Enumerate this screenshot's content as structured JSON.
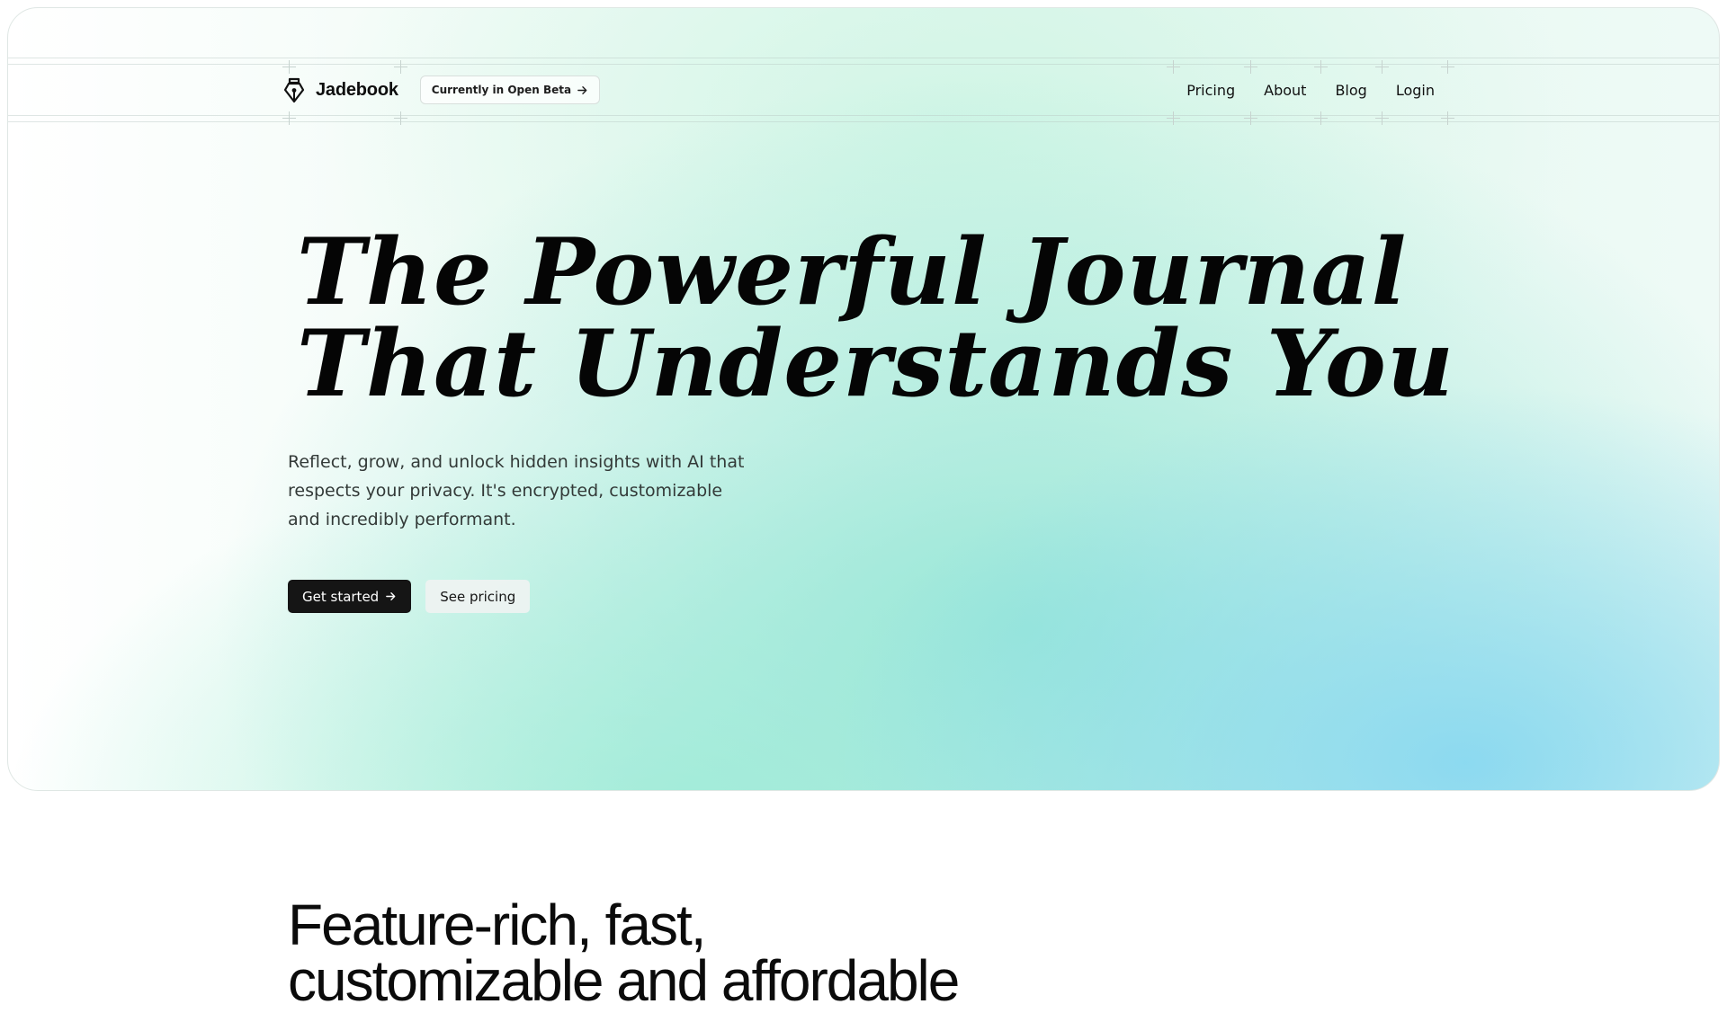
{
  "brand": {
    "name": "Jadebook",
    "logo_icon": "pen-nib-icon"
  },
  "beta_badge": {
    "label": "Currently in Open Beta",
    "icon": "arrow-right-icon"
  },
  "nav": {
    "links": [
      {
        "label": "Pricing"
      },
      {
        "label": "About"
      },
      {
        "label": "Blog"
      },
      {
        "label": "Login"
      }
    ]
  },
  "hero": {
    "title_lines": [
      "The Powerful Journal",
      "That Understands You"
    ],
    "subtitle": "Reflect, grow, and unlock hidden insights with AI that respects your privacy. It's encrypted, customizable and incredibly performant.",
    "primary_cta": "Get started",
    "primary_cta_icon": "arrow-right-icon",
    "secondary_cta": "See pricing"
  },
  "features": {
    "heading_lines": [
      "Feature-rich, fast,",
      "customizable and affordable"
    ]
  },
  "colors": {
    "accent_dark": "#151515",
    "gradient_mint": "#96e6d7",
    "gradient_sky": "#89d8f0"
  }
}
